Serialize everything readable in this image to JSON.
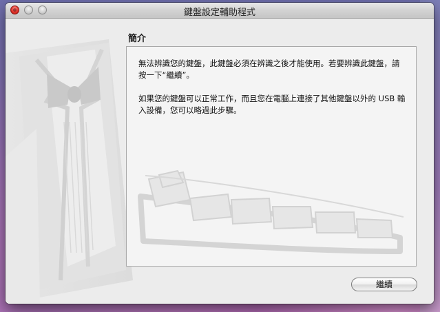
{
  "window": {
    "title": "鍵盤設定輔助程式"
  },
  "section": {
    "heading": "簡介"
  },
  "intro": {
    "paragraph1": "無法辨識您的鍵盤，此鍵盤必須在辨識之後才能使用。若要辨識此鍵盤，請按一下“繼續”。",
    "paragraph2": "如果您的鍵盤可以正常工作，而且您在電腦上連接了其他鍵盤以外的 USB 輸入設備，您可以略過此步驟。"
  },
  "buttons": {
    "continue_label": "繼續"
  }
}
